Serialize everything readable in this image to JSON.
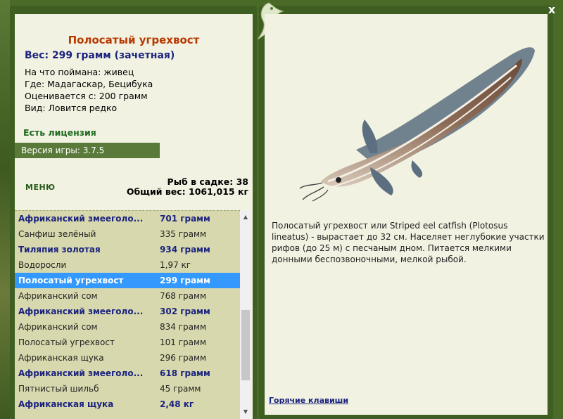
{
  "window": {
    "close_label": "x"
  },
  "fish": {
    "title": "Полосатый угрехвост",
    "weight": "Вес: 299 грамм (зачетная)",
    "caught_on": "На что поймана: живец",
    "location": "Где: Мадагаскар, Бецибука",
    "valued_from": "Оценивается с: 200 грамм",
    "kind": "Вид: Ловится редко",
    "description": "Полосатый угрехвост или Striped eel catfish (Plotosus lineatus) - вырастает до 32 см. Населяет неглубокие участки рифов (до 25 м) с песчаным дном. Питается мелкими донными беспозвоночными, мелкой рыбой."
  },
  "license": "Есть лицензия",
  "version": "Версия игры: 3.7.5",
  "menu_label": "МЕНЮ",
  "stats": {
    "fish_in_tank": "Рыб в садке: 38",
    "total_weight": "Общий вес: 1061,015 кг"
  },
  "catch_list": [
    {
      "name": "Африканский змееголо...",
      "weight": "701 грамм",
      "style": "bold"
    },
    {
      "name": "Санфиш зелёный",
      "weight": "335 грамм",
      "style": "normal"
    },
    {
      "name": "Тиляпия золотая",
      "weight": "934 грамм",
      "style": "bold"
    },
    {
      "name": "Водоросли",
      "weight": "1,97 кг",
      "style": "normal"
    },
    {
      "name": "Полосатый угрехвост",
      "weight": "299 грамм",
      "style": "selected"
    },
    {
      "name": "Африканский сом",
      "weight": "768 грамм",
      "style": "normal"
    },
    {
      "name": "Африканский змееголо...",
      "weight": "302 грамм",
      "style": "bold"
    },
    {
      "name": "Африканский сом",
      "weight": "834 грамм",
      "style": "normal"
    },
    {
      "name": "Полосатый угрехвост",
      "weight": "101 грамм",
      "style": "normal"
    },
    {
      "name": "Африканская щука",
      "weight": "296 грамм",
      "style": "normal"
    },
    {
      "name": "Африканский змееголо...",
      "weight": "618 грамм",
      "style": "bold"
    },
    {
      "name": "Пятнистый шильб",
      "weight": "45 грамм",
      "style": "normal"
    },
    {
      "name": "Африканская щука",
      "weight": "2,48 кг",
      "style": "bold"
    }
  ],
  "hotkeys_label": "Горячие клавиши",
  "colors": {
    "frame": "#3f5f22",
    "panel": "#f2f2e2",
    "title": "#b83800",
    "accent_blue": "#1a237e",
    "selection": "#3399ff"
  }
}
